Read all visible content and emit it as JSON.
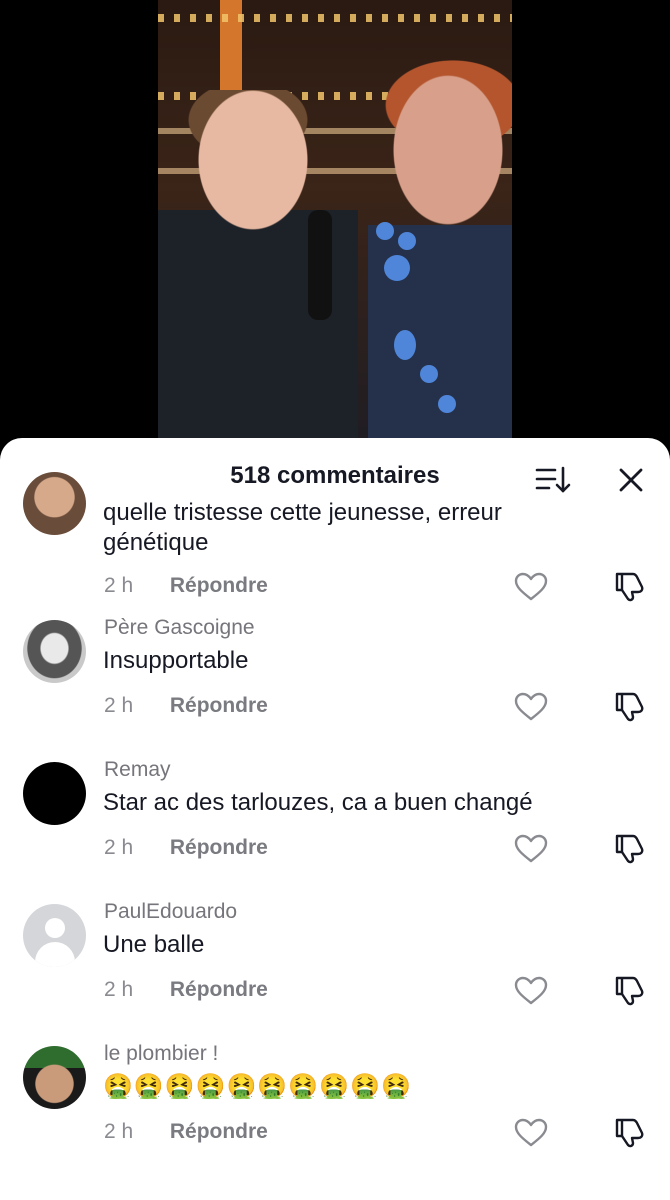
{
  "video": {},
  "sheet": {
    "title": "518 commentaires",
    "sort_icon": "sort-descending-icon",
    "close_icon": "close-icon"
  },
  "comments": [
    {
      "username": "",
      "text_line1": "quelle tristesse cette jeunesse, erreur",
      "text_line2": "génétique",
      "time": "2 h",
      "reply": "Répondre",
      "avatar": "bearded-man-avatar"
    },
    {
      "username": "Père Gascoigne",
      "text": "Insupportable",
      "time": "2 h",
      "reply": "Répondre",
      "avatar": "bw-portrait-avatar"
    },
    {
      "username": "Remay",
      "text": "Star ac des tarlouzes, ca a buen changé",
      "time": "2 h",
      "reply": "Répondre",
      "avatar": "black-avatar"
    },
    {
      "username": "PaulEdouardo",
      "text": "Une balle",
      "time": "2 h",
      "reply": "Répondre",
      "avatar": "default-avatar"
    },
    {
      "username": "le plombier !",
      "text": "🤮🤮🤮🤮🤮🤮🤮🤮🤮🤮",
      "time": "2 h",
      "reply": "Répondre",
      "avatar": "luigi-avatar"
    }
  ]
}
